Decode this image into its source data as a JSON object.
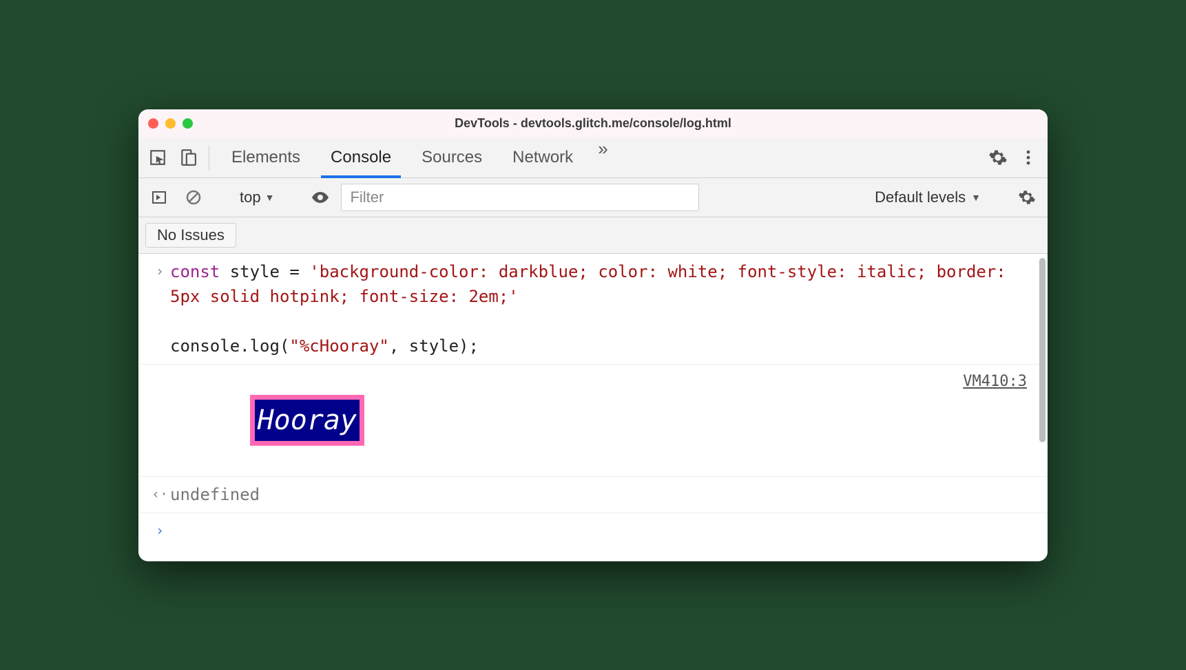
{
  "window": {
    "title": "DevTools - devtools.glitch.me/console/log.html"
  },
  "tabs": {
    "elements": "Elements",
    "console": "Console",
    "sources": "Sources",
    "network": "Network"
  },
  "filterbar": {
    "context": "top",
    "filter_placeholder": "Filter",
    "levels": "Default levels"
  },
  "issues": {
    "no_issues": "No Issues"
  },
  "console": {
    "code_kw": "const",
    "code_var": " style = ",
    "code_str": "'background-color: darkblue; color: white; font-style: italic; border: 5px solid hotpink; font-size: 2em;'",
    "code_call": "console.log(",
    "code_arg": "\"%cHooray\"",
    "code_rest": ", style);",
    "styled_text": "Hooray",
    "source_link": "VM410:3",
    "return_value": "undefined"
  }
}
